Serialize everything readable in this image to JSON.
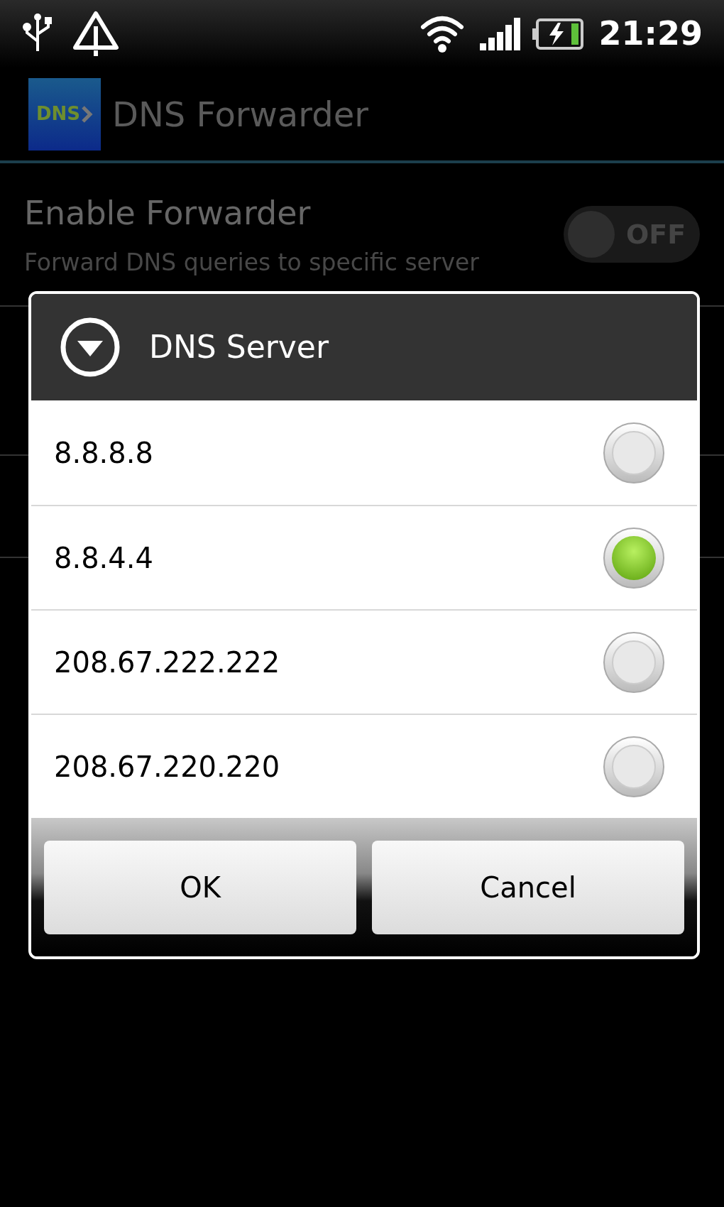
{
  "status_bar": {
    "time": "21:29"
  },
  "app_bar": {
    "logo_text": "DNS",
    "title": "DNS Forwarder"
  },
  "settings": [
    {
      "title": "Enable Forwarder",
      "summary": "Forward DNS queries to specific server",
      "toggle": {
        "on": false,
        "label": "OFF"
      }
    }
  ],
  "dialog": {
    "title": "DNS Server",
    "options": [
      {
        "label": "8.8.8.8",
        "selected": false
      },
      {
        "label": "8.8.4.4",
        "selected": true
      },
      {
        "label": "208.67.222.222",
        "selected": false
      },
      {
        "label": "208.67.220.220",
        "selected": false
      }
    ],
    "buttons": [
      "OK",
      "Cancel"
    ]
  }
}
